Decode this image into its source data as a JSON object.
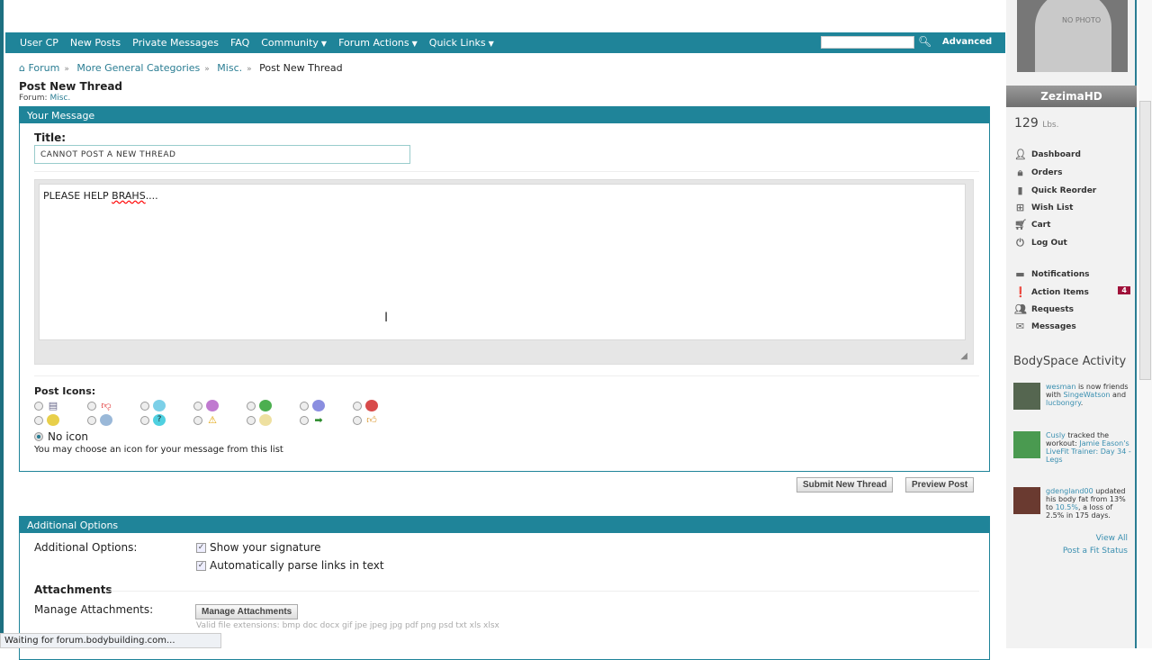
{
  "nav": {
    "items": [
      {
        "label": "User CP"
      },
      {
        "label": "New Posts"
      },
      {
        "label": "Private Messages"
      },
      {
        "label": "FAQ"
      },
      {
        "label": "Community",
        "dropdown": true
      },
      {
        "label": "Forum Actions",
        "dropdown": true
      },
      {
        "label": "Quick Links",
        "dropdown": true
      }
    ],
    "search_value": "",
    "advanced": "Advanced"
  },
  "breadcrumb": [
    "Forum",
    "More General Categories",
    "Misc.",
    "Post New Thread"
  ],
  "page": {
    "title": "Post New Thread",
    "forum_label": "Forum:",
    "forum": "Misc."
  },
  "message": {
    "header": "Your Message",
    "title_label": "Title:",
    "title_value": "CANNOT POST A NEW THREAD",
    "body_plain": "PLEASE HELP ",
    "body_misspelled": "BRAHS",
    "body_tail": "....",
    "post_icons_label": "Post Icons:",
    "no_icon": "No icon",
    "hint": "You may choose an icon for your message from this list"
  },
  "buttons": {
    "submit": "Submit New Thread",
    "preview": "Preview Post",
    "manage": "Manage Attachments"
  },
  "options": {
    "header": "Additional Options",
    "label": "Additional Options:",
    "show_sig": "Show your signature",
    "parse_links": "Automatically parse links in text",
    "attachments": "Attachments",
    "manage_label": "Manage Attachments:",
    "extensions": "Valid file extensions: bmp doc docx gif jpe jpeg jpg pdf png psd txt xls xlsx"
  },
  "status": "Waiting for forum.bodybuilding.com...",
  "sidebar": {
    "no_photo": "NO PHOTO",
    "username": "ZezimaHD",
    "weight": "129",
    "weight_unit": "Lbs.",
    "links": [
      "Dashboard",
      "Orders",
      "Quick Reorder",
      "Wish List",
      "Cart",
      "Log Out"
    ],
    "links2": [
      "Notifications",
      "Action Items",
      "Requests",
      "Messages"
    ],
    "action_count": "4",
    "activity_title": "BodySpace Activity",
    "activity": [
      {
        "user": "wesman",
        "t1": " is now friends with ",
        "l2": "SingeWatson",
        "t2": " and ",
        "l3": "lucbongry",
        "t3": "."
      },
      {
        "user": "Cusly",
        "t1": " tracked the workout: ",
        "l2": "Jamie Eason's LiveFit Trainer: Day 34 - Legs",
        "t2": "",
        "l3": "",
        "t3": ""
      },
      {
        "user": "gdengland00",
        "t1": " updated his body fat from 13% to ",
        "l2": "10.5%",
        "t2": ", a loss of 2.5% in 175 days.",
        "l3": "",
        "t3": ""
      }
    ],
    "view_all": "View All",
    "post_fit": "Post a Fit Status"
  },
  "colors": {
    "accent": "#1f8499",
    "badge": "#a0123a"
  }
}
